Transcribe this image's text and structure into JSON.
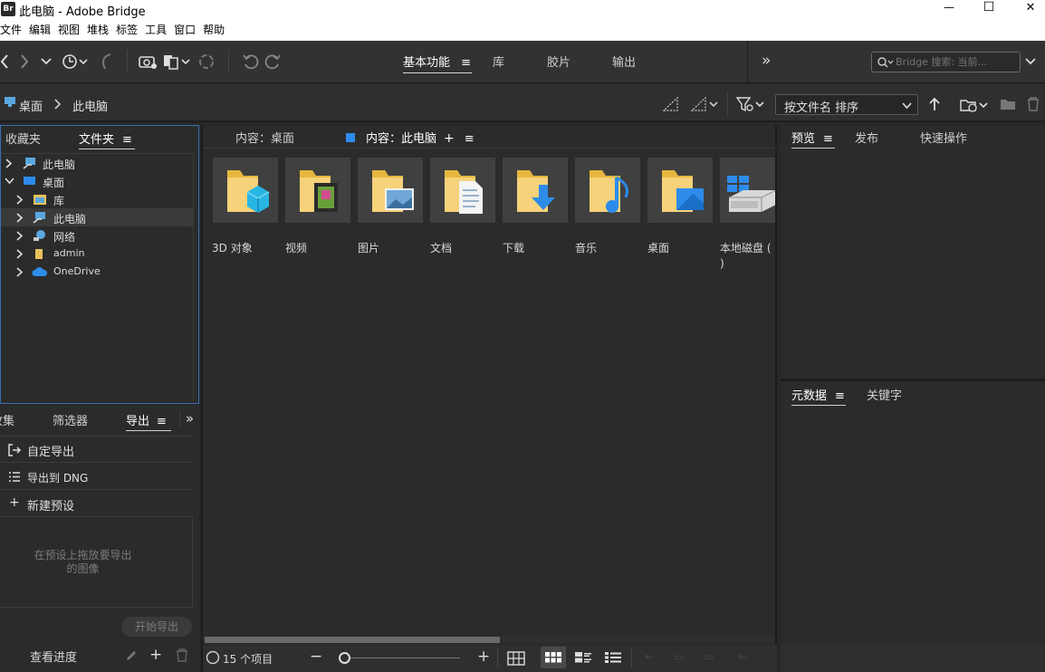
{
  "window": {
    "app_icon_text": "Br",
    "title": "此电脑 - Adobe Bridge",
    "minimize_symbol": "—",
    "maximize_symbol": "☐",
    "close_symbol": "✕"
  },
  "menu": [
    "文件",
    "编辑",
    "视图",
    "堆栈",
    "标签",
    "工具",
    "窗口",
    "帮助"
  ],
  "workspaces": {
    "tabs": [
      "基本功能",
      "库",
      "胶片",
      "输出"
    ],
    "active": "基本功能",
    "more_symbol": "»"
  },
  "search": {
    "placeholder": "Bridge 搜索: 当前..."
  },
  "breadcrumb": [
    "桌面",
    "此电脑"
  ],
  "sort": {
    "label": "按文件名 排序"
  },
  "left_top_panel": {
    "tabs": [
      "收藏夹",
      "文件夹"
    ],
    "active": "文件夹",
    "tree": [
      {
        "label": "此电脑",
        "level": 0,
        "expanded": false,
        "icon": "computer-icon"
      },
      {
        "label": "桌面",
        "level": 0,
        "expanded": true,
        "icon": "desktop-icon"
      },
      {
        "label": "库",
        "level": 1,
        "expanded": false,
        "icon": "library-icon"
      },
      {
        "label": "此电脑",
        "level": 1,
        "expanded": false,
        "icon": "computer-icon",
        "selected": true
      },
      {
        "label": "网络",
        "level": 1,
        "expanded": false,
        "icon": "network-icon"
      },
      {
        "label": "admin",
        "level": 1,
        "expanded": false,
        "icon": "user-folder-icon"
      },
      {
        "label": "OneDrive",
        "level": 1,
        "expanded": false,
        "icon": "cloud-icon"
      }
    ]
  },
  "left_bottom_panel": {
    "tabs": [
      "收集",
      "筛选器",
      "导出"
    ],
    "active": "导出",
    "items": [
      {
        "label": "自定导出",
        "icon": "export-icon"
      },
      {
        "label": "导出到 DNG",
        "icon": "list-icon"
      },
      {
        "label": "新建预设",
        "icon": "plus-icon"
      }
    ],
    "hint_line1": "在预设上拖放要导出",
    "hint_line2": "的图像",
    "start_button": "开始导出",
    "progress_label": "查看进度"
  },
  "content": {
    "tabs": [
      "内容：桌面",
      "内容：此电脑"
    ],
    "active": "内容：此电脑",
    "items": [
      {
        "label": "3D 对象",
        "icon": "3d-objects-folder-icon"
      },
      {
        "label": "视频",
        "icon": "videos-folder-icon"
      },
      {
        "label": "图片",
        "icon": "pictures-folder-icon"
      },
      {
        "label": "文档",
        "icon": "documents-folder-icon"
      },
      {
        "label": "下载",
        "icon": "downloads-folder-icon"
      },
      {
        "label": "音乐",
        "icon": "music-folder-icon"
      },
      {
        "label": "桌面",
        "icon": "desktop-folder-icon"
      },
      {
        "label": "本地磁盘 (C:)",
        "label_line1": "本地磁盘 (",
        "label_line2": ")",
        "icon": "local-disk-icon"
      }
    ],
    "item_count": "15 个项目"
  },
  "right_top_panel": {
    "tabs": [
      "预览",
      "发布",
      "快速操作"
    ],
    "active": "预览"
  },
  "right_bottom_panel": {
    "tabs": [
      "元数据",
      "关键字"
    ],
    "active": "元数据"
  },
  "thumbnail_slider": 0.0,
  "colors": {
    "accent_blue": "#2d8ceb",
    "panel_bg": "#2b2b2b",
    "app_bar_bg": "#323232"
  }
}
